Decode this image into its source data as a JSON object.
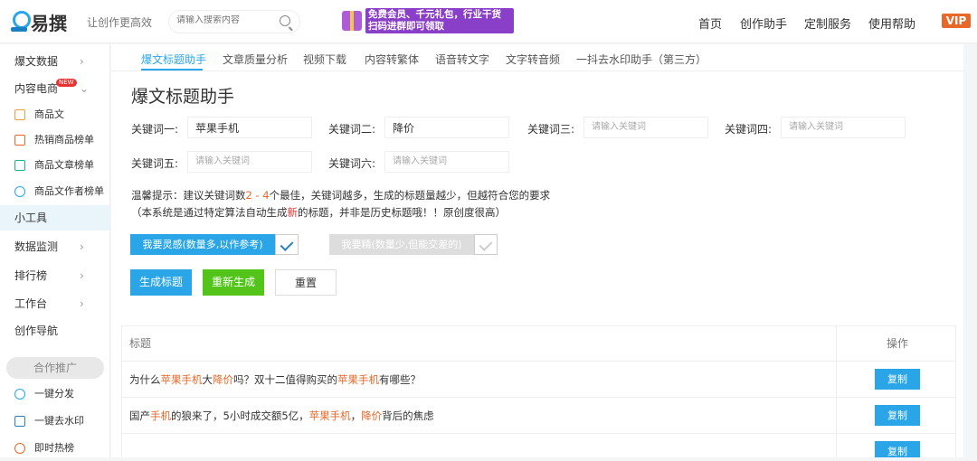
{
  "header": {
    "brand": "易撰",
    "slogan": "让创作更高效",
    "search_placeholder": "请输入搜索内容",
    "promo": "免费会员、千元礼包，行业干货 扫码进群即可领取",
    "nav": [
      "首页",
      "创作助手",
      "定制服务",
      "使用帮助"
    ],
    "vip": "VIP"
  },
  "sidebar": {
    "items": [
      {
        "label": "爆文数据",
        "chev": "›"
      },
      {
        "label": "内容电商",
        "badge": "NEW",
        "chev": "⌄"
      },
      {
        "label": "商品文"
      },
      {
        "label": "热销商品榜单"
      },
      {
        "label": "商品文章榜单"
      },
      {
        "label": "商品文作者榜单"
      },
      {
        "label": "小工具"
      },
      {
        "label": "数据监测",
        "chev": "›"
      },
      {
        "label": "排行榜",
        "chev": "›"
      },
      {
        "label": "工作台",
        "chev": "›"
      },
      {
        "label": "创作导航"
      },
      {
        "label": "一键分发"
      },
      {
        "label": "一键去水印"
      },
      {
        "label": "即时热榜"
      }
    ],
    "promo_section": "合作推广"
  },
  "tabs": [
    "爆文标题助手",
    "文章质量分析",
    "视频下载",
    "内容转繁体",
    "语音转文字",
    "文字转音频",
    "一抖去水印助手（第三方）"
  ],
  "page_title": "爆文标题助手",
  "keywords": [
    {
      "label": "关键词一:",
      "value": "苹果手机",
      "placeholder": "请输入关键词"
    },
    {
      "label": "关键词二:",
      "value": "降价",
      "placeholder": "请输入关键词"
    },
    {
      "label": "关键词三:",
      "value": "",
      "placeholder": "请输入关键词"
    },
    {
      "label": "关键词四:",
      "value": "",
      "placeholder": "请输入关键词"
    },
    {
      "label": "关键词五:",
      "value": "",
      "placeholder": "请输入关键词"
    },
    {
      "label": "关键词六:",
      "value": "",
      "placeholder": "请输入关键词"
    }
  ],
  "tips": {
    "a": "温馨提示：建议关键词数",
    "b": "2 - 4",
    "c": "个最佳，关键词越多，生成的标题量越少，但越符合您的要求",
    "d": "（本系统是通过特定算法自动生成",
    "e": "新",
    "f": "的标题，并非是历史标题哦！！原创度很高）"
  },
  "toggles": {
    "inspire": "我要灵感(数量多,以作参考)",
    "precise": "我要精(数量少,但能交差的)"
  },
  "buttons": {
    "generate": "生成标题",
    "regenerate": "重新生成",
    "reset": "重置"
  },
  "colors": {
    "accent": "#2aa6e8",
    "green": "#52c41a",
    "highlight": "#e8682a"
  },
  "table": {
    "headers": [
      "标题",
      "操作"
    ],
    "copy_label": "复制",
    "rows": [
      [
        [
          "为什么",
          0
        ],
        [
          "苹果手机",
          1
        ],
        [
          "大",
          0
        ],
        [
          "降价",
          1
        ],
        [
          "吗？双十二值得购买的",
          0
        ],
        [
          "苹果手机",
          1
        ],
        [
          "有哪些？",
          0
        ]
      ],
      [
        [
          "国产",
          0
        ],
        [
          "手机",
          1
        ],
        [
          "的狼来了，5小时成交额5亿，",
          0
        ],
        [
          "苹果手机",
          1
        ],
        [
          "，",
          0
        ],
        [
          "降价",
          1
        ],
        [
          "背后的焦虑",
          0
        ]
      ]
    ]
  }
}
